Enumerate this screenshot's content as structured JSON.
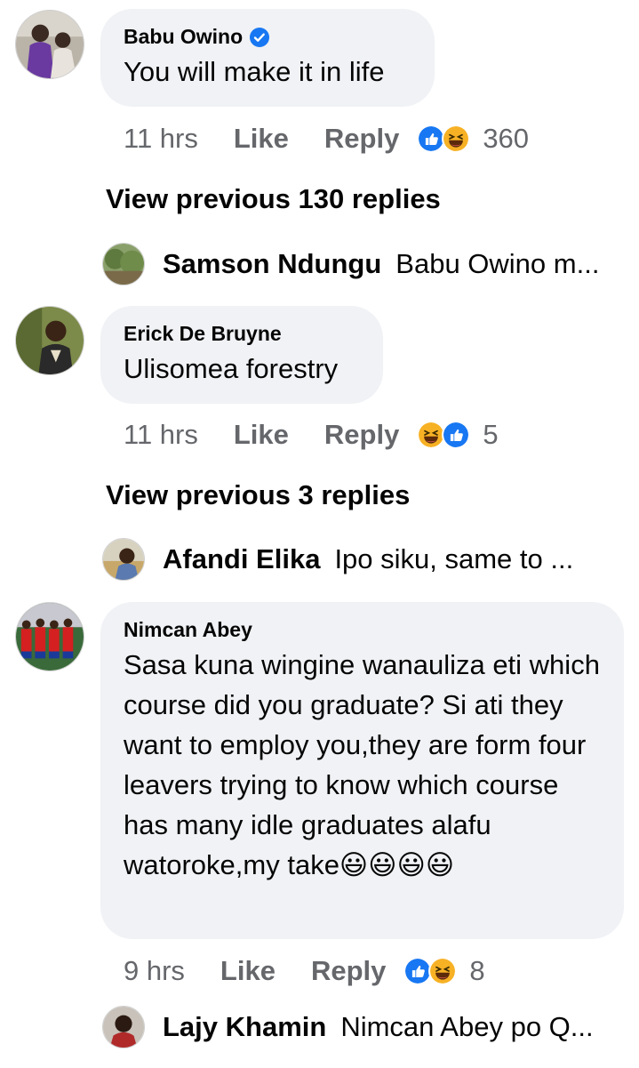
{
  "comments": [
    {
      "author": "Babu Owino",
      "text": "You will make it in life",
      "time": "11 hrs",
      "like": "Like",
      "reply": "Reply",
      "count": "360",
      "view_previous": "View previous 130 replies",
      "preview_name": "Samson Ndungu",
      "preview_text": "Babu Owino m..."
    },
    {
      "author": "Erick De Bruyne",
      "text": "Ulisomea forestry",
      "time": "11 hrs",
      "like": "Like",
      "reply": "Reply",
      "count": "5",
      "view_previous": "View previous 3 replies",
      "preview_name": "Afandi Elika",
      "preview_text": "Ipo siku, same to ..."
    },
    {
      "author": "Nimcan Abey",
      "text": "Sasa kuna wingine wanauliza eti which course did you graduate? Si ati they want to employ you,they are form four leavers trying to know which course has many idle graduates alafu watoroke,my take😃😃😃😃",
      "time": "9 hrs",
      "like": "Like",
      "reply": "Reply",
      "count": "8",
      "preview_name": "Lajy Khamin",
      "preview_text": "Nimcan Abey po Q..."
    }
  ],
  "colors": {
    "bubble": "#f0f2f5",
    "meta": "#65676b",
    "like_blue": "#1877f2",
    "haha_yellow": "#f7b125"
  },
  "icons": [
    "verified-badge-icon",
    "like-reaction-icon",
    "haha-reaction-icon"
  ]
}
